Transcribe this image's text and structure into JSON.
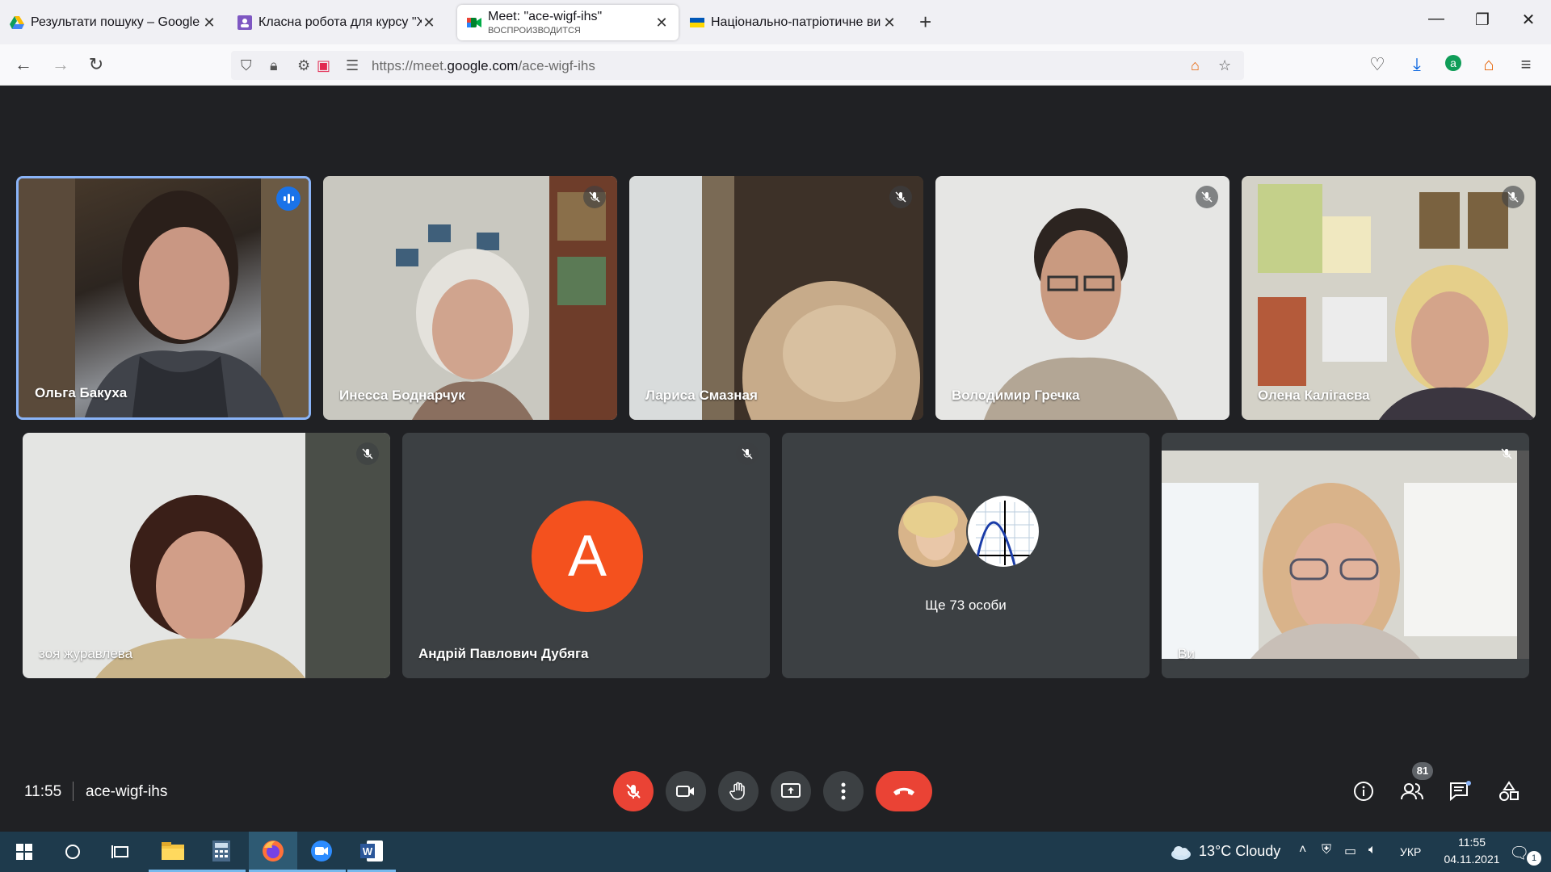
{
  "browser": {
    "tabs": [
      {
        "title": "Результати пошуку – Google Д",
        "favicon": "google-drive-icon"
      },
      {
        "title": "Класна робота для курсу \"Хім",
        "favicon": "google-classroom-icon"
      },
      {
        "title": "Meet: \"ace-wigf-ihs\"",
        "subtitle": "ВОСПРОИЗВОДИТСЯ",
        "favicon": "google-meet-icon",
        "active": true
      },
      {
        "title": "Національно-патріотичне ви",
        "favicon": "ukraine-flag-icon"
      }
    ],
    "url": {
      "prefix": "https://meet.",
      "domain": "google.com",
      "path": "/ace-wigf-ihs"
    }
  },
  "meet": {
    "participants_row1": [
      {
        "name": "Ольга Бакуха",
        "speaking": true
      },
      {
        "name": "Инесса Боднарчук",
        "muted": true
      },
      {
        "name": "Лариса Смазная",
        "muted": true
      },
      {
        "name": "Володимир Гречка",
        "muted": true
      },
      {
        "name": "Олена Калігаєва",
        "muted": true
      }
    ],
    "participants_row2": [
      {
        "name": "зоя журавлева",
        "muted": true
      },
      {
        "name": "Андрій Павлович Дубяга",
        "avatar_letter": "A",
        "muted": true
      },
      {
        "more_text": "Ще 73 особи"
      },
      {
        "name": "Ви",
        "muted": true
      }
    ],
    "bottom": {
      "time": "11:55",
      "meeting_code": "ace-wigf-ihs",
      "people_count": "81"
    }
  },
  "taskbar": {
    "weather": "13°C  Cloudy",
    "language": "УКР",
    "time": "11:55",
    "date": "04.11.2021",
    "notifications": "1"
  },
  "colors": {
    "meet_bg": "#202124",
    "tile_bg": "#3c4043",
    "end_call": "#ea4335",
    "avatar": "#f4511e",
    "speaking": "#1a73e8"
  }
}
